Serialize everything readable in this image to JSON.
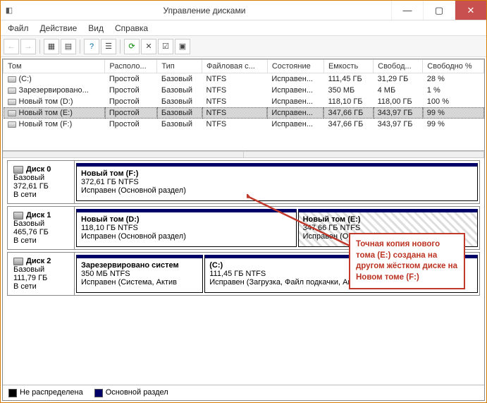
{
  "window": {
    "title": "Управление дисками",
    "min": "—",
    "max": "▢",
    "close": "✕"
  },
  "menu": {
    "file": "Файл",
    "action": "Действие",
    "view": "Вид",
    "help": "Справка"
  },
  "columns": {
    "vol": "Том",
    "layout": "Располо...",
    "type": "Тип",
    "fs": "Файловая с...",
    "status": "Состояние",
    "cap": "Емкость",
    "free": "Свобод...",
    "pct": "Свободно %"
  },
  "rows": [
    {
      "vol": "(C:)",
      "layout": "Простой",
      "type": "Базовый",
      "fs": "NTFS",
      "status": "Исправен...",
      "cap": "111,45 ГБ",
      "free": "31,29 ГБ",
      "pct": "28 %",
      "sel": false
    },
    {
      "vol": "Зарезервировано...",
      "layout": "Простой",
      "type": "Базовый",
      "fs": "NTFS",
      "status": "Исправен...",
      "cap": "350 МБ",
      "free": "4 МБ",
      "pct": "1 %",
      "sel": false
    },
    {
      "vol": "Новый том (D:)",
      "layout": "Простой",
      "type": "Базовый",
      "fs": "NTFS",
      "status": "Исправен...",
      "cap": "118,10 ГБ",
      "free": "118,00 ГБ",
      "pct": "100 %",
      "sel": false
    },
    {
      "vol": "Новый том (E:)",
      "layout": "Простой",
      "type": "Базовый",
      "fs": "NTFS",
      "status": "Исправен...",
      "cap": "347,66 ГБ",
      "free": "343,97 ГБ",
      "pct": "99 %",
      "sel": true
    },
    {
      "vol": "Новый том (F:)",
      "layout": "Простой",
      "type": "Базовый",
      "fs": "NTFS",
      "status": "Исправен...",
      "cap": "347,66 ГБ",
      "free": "343,97 ГБ",
      "pct": "99 %",
      "sel": false
    }
  ],
  "disks": [
    {
      "name": "Диск 0",
      "type": "Базовый",
      "size": "372,61 ГБ",
      "state": "В сети",
      "parts": [
        {
          "title": "Новый том  (F:)",
          "sub": "372,61 ГБ NTFS",
          "st": "Исправен (Основной раздел)",
          "grow": 1,
          "hatch": false
        }
      ]
    },
    {
      "name": "Диск 1",
      "type": "Базовый",
      "size": "465,76 ГБ",
      "state": "В сети",
      "parts": [
        {
          "title": "Новый том  (D:)",
          "sub": "118,10 ГБ NTFS",
          "st": "Исправен (Основной раздел)",
          "grow": 1,
          "hatch": false
        },
        {
          "title": "Новый том  (E:)",
          "sub": "347,66 ГБ NTFS",
          "st": "Исправен (Основной",
          "grow": 0.9,
          "hatch": true
        }
      ]
    },
    {
      "name": "Диск 2",
      "type": "Базовый",
      "size": "111,79 ГБ",
      "state": "В сети",
      "parts": [
        {
          "title": "Зарезервировано систем",
          "sub": "350 МБ NTFS",
          "st": "Исправен (Система, Актив",
          "grow": 0.45,
          "hatch": false
        },
        {
          "title": "(C:)",
          "sub": "111,45 ГБ NTFS",
          "st": "Исправен (Загрузка, Файл подкачки, Аварийный дамп ...",
          "grow": 1.4,
          "hatch": false
        }
      ]
    }
  ],
  "legend": {
    "unalloc": "Не распределена",
    "primary": "Основной раздел"
  },
  "callout": "Точная копия нового тома (E:) создана на другом жёстком диске на Новом томе (F:)"
}
